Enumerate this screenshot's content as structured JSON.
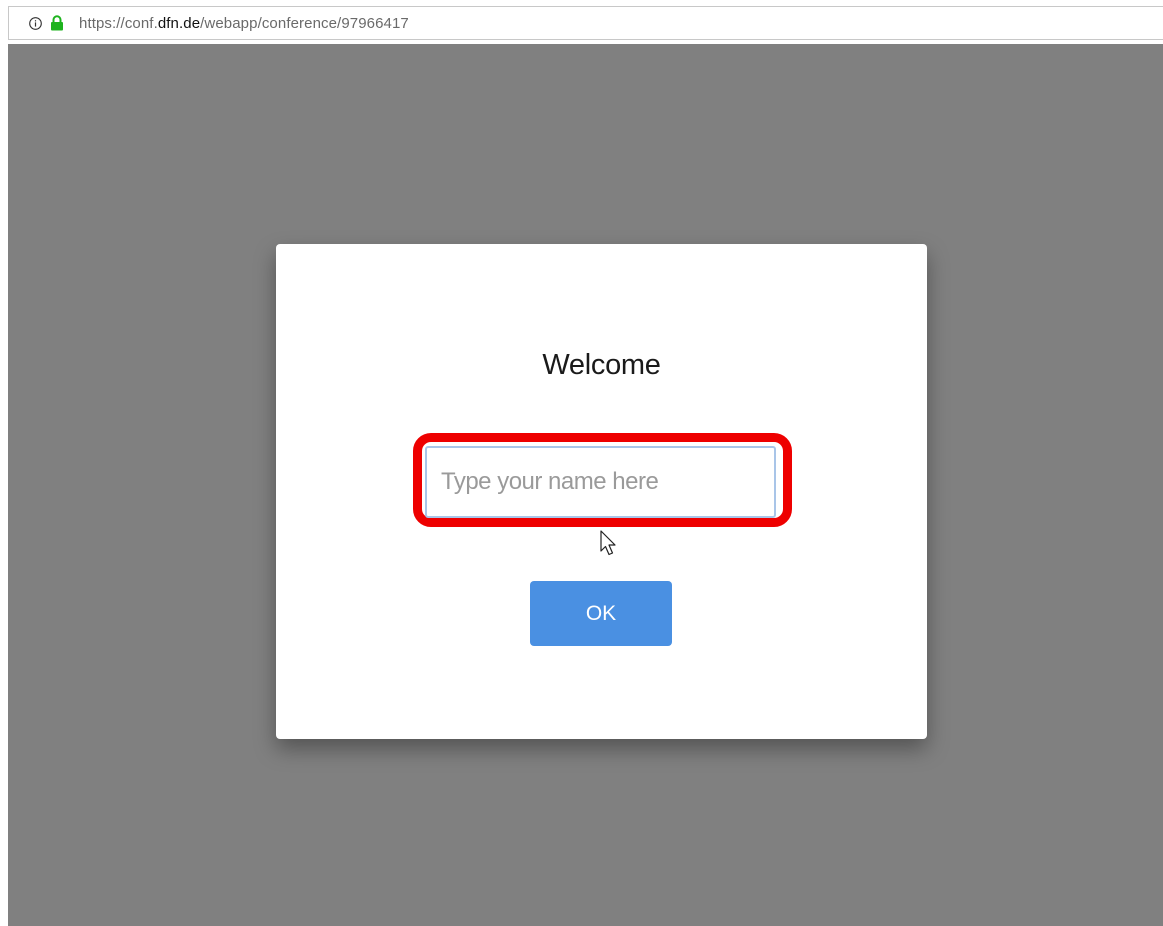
{
  "browser": {
    "url_prefix": "https://conf.",
    "url_domain": "dfn.de",
    "url_path": "/webapp/conference/97966417",
    "info_icon": "info-icon",
    "lock_icon": "lock-icon",
    "lock_color": "#1db31d"
  },
  "dialog": {
    "title": "Welcome",
    "name_placeholder": "Type your name here",
    "name_value": "",
    "ok_label": "OK",
    "ok_color": "#4a90e2",
    "highlight_color": "#ee0000"
  },
  "overlay_color": "#808080"
}
